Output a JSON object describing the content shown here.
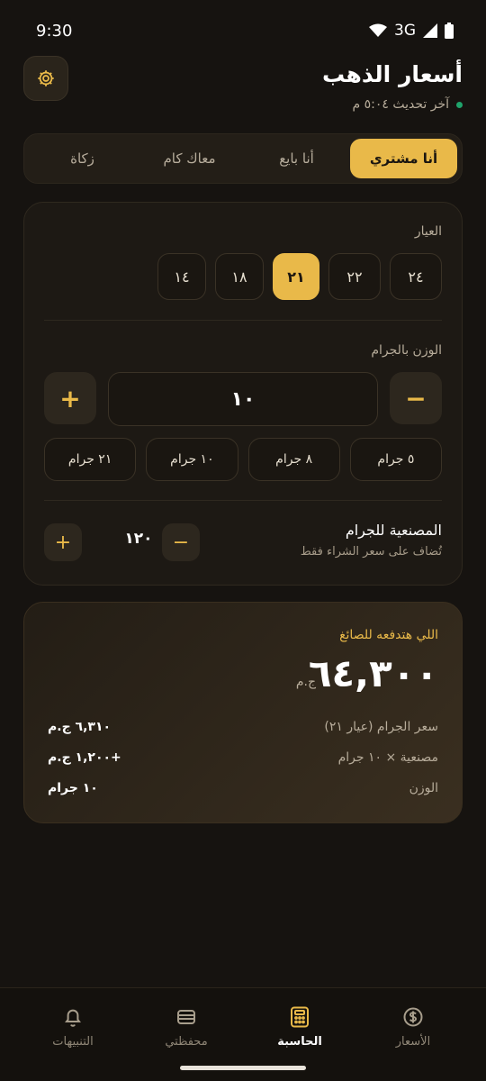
{
  "status_bar": {
    "time": "9:30",
    "network": "3G"
  },
  "header": {
    "title": "أسعار الذهب",
    "subtitle": "آخر تحديث ٥:٠٤ م",
    "settings_icon": "gear-icon"
  },
  "tabs": [
    {
      "label": "أنا مشتري",
      "active": true
    },
    {
      "label": "أنا بايع",
      "active": false
    },
    {
      "label": "معاك كام",
      "active": false
    },
    {
      "label": "زكاة",
      "active": false
    }
  ],
  "karat": {
    "label": "العيار",
    "options": [
      "٢٤",
      "٢٢",
      "٢١",
      "١٨",
      "١٤"
    ],
    "selected": "٢١"
  },
  "weight": {
    "label": "الوزن بالجرام",
    "value": "١٠",
    "minus": "−",
    "plus": "+",
    "presets": [
      "٥ جرام",
      "٨ جرام",
      "١٠ جرام",
      "٢١ جرام"
    ]
  },
  "making": {
    "title": "المصنعية للجرام",
    "subtitle": "تُضاف على سعر الشراء فقط",
    "value": "١٢٠",
    "minus": "−",
    "plus": "+"
  },
  "result": {
    "label": "اللي هتدفعه للصائغ",
    "total": "٦٤,٣٠٠",
    "currency": "ج.م",
    "rows": [
      {
        "key": "سعر الجرام (عيار ٢١)",
        "value": "٦,٣١٠ ج.م"
      },
      {
        "key": "مصنعية × ١٠ جرام",
        "value": "+١,٢٠٠ ج.م"
      },
      {
        "key": "الوزن",
        "value": "١٠ جرام"
      }
    ]
  },
  "nav": [
    {
      "label": "الأسعار",
      "icon": "dollar-circle-icon",
      "active": false
    },
    {
      "label": "الحاسبة",
      "icon": "calculator-icon",
      "active": true
    },
    {
      "label": "محفظتي",
      "icon": "wallet-icon",
      "active": false
    },
    {
      "label": "التنبيهات",
      "icon": "bell-icon",
      "active": false
    }
  ],
  "colors": {
    "accent": "#e9b949",
    "background": "#161310",
    "card": "#1d1914",
    "live_dot": "#1fa36b"
  }
}
